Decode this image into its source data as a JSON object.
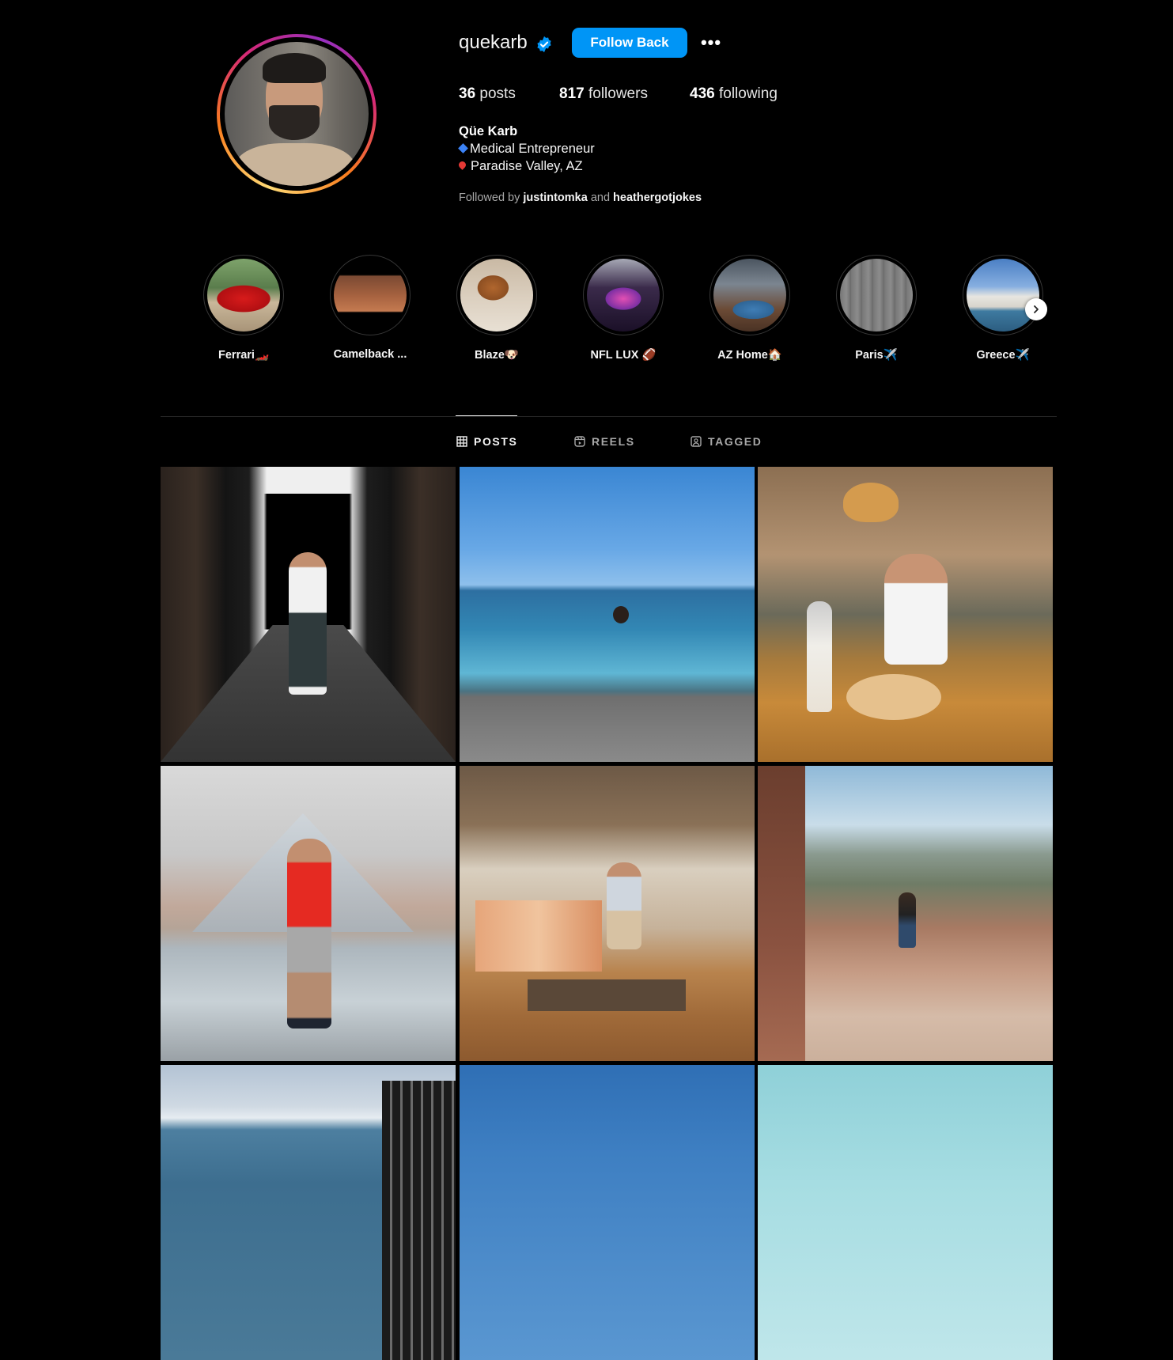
{
  "profile": {
    "username": "quekarb",
    "follow_back_label": "Follow Back",
    "more_label": "•••",
    "stats": {
      "posts_count": "36",
      "posts_label": "posts",
      "followers_count": "817",
      "followers_label": "followers",
      "following_count": "436",
      "following_label": "following"
    },
    "full_name": "Qüe Karb",
    "bio_line1": "Medical Entrepreneur",
    "bio_line2": "Paradise Valley, AZ",
    "followed_by_prefix": "Followed by",
    "followed_by_user1": "justintomka",
    "followed_by_and": "and",
    "followed_by_user2": "heathergotjokes"
  },
  "highlights": [
    {
      "label": "Ferrari🏎️"
    },
    {
      "label": "Camelback ..."
    },
    {
      "label": "Blaze🐶"
    },
    {
      "label": "NFL LUX 🏈"
    },
    {
      "label": "AZ Home🏠"
    },
    {
      "label": "Paris✈️"
    },
    {
      "label": "Greece✈️"
    }
  ],
  "tabs": {
    "posts": "POSTS",
    "reels": "REELS",
    "tagged": "TAGGED"
  },
  "colors": {
    "accent": "#0095f6",
    "background": "#000000",
    "divider": "#262626"
  }
}
